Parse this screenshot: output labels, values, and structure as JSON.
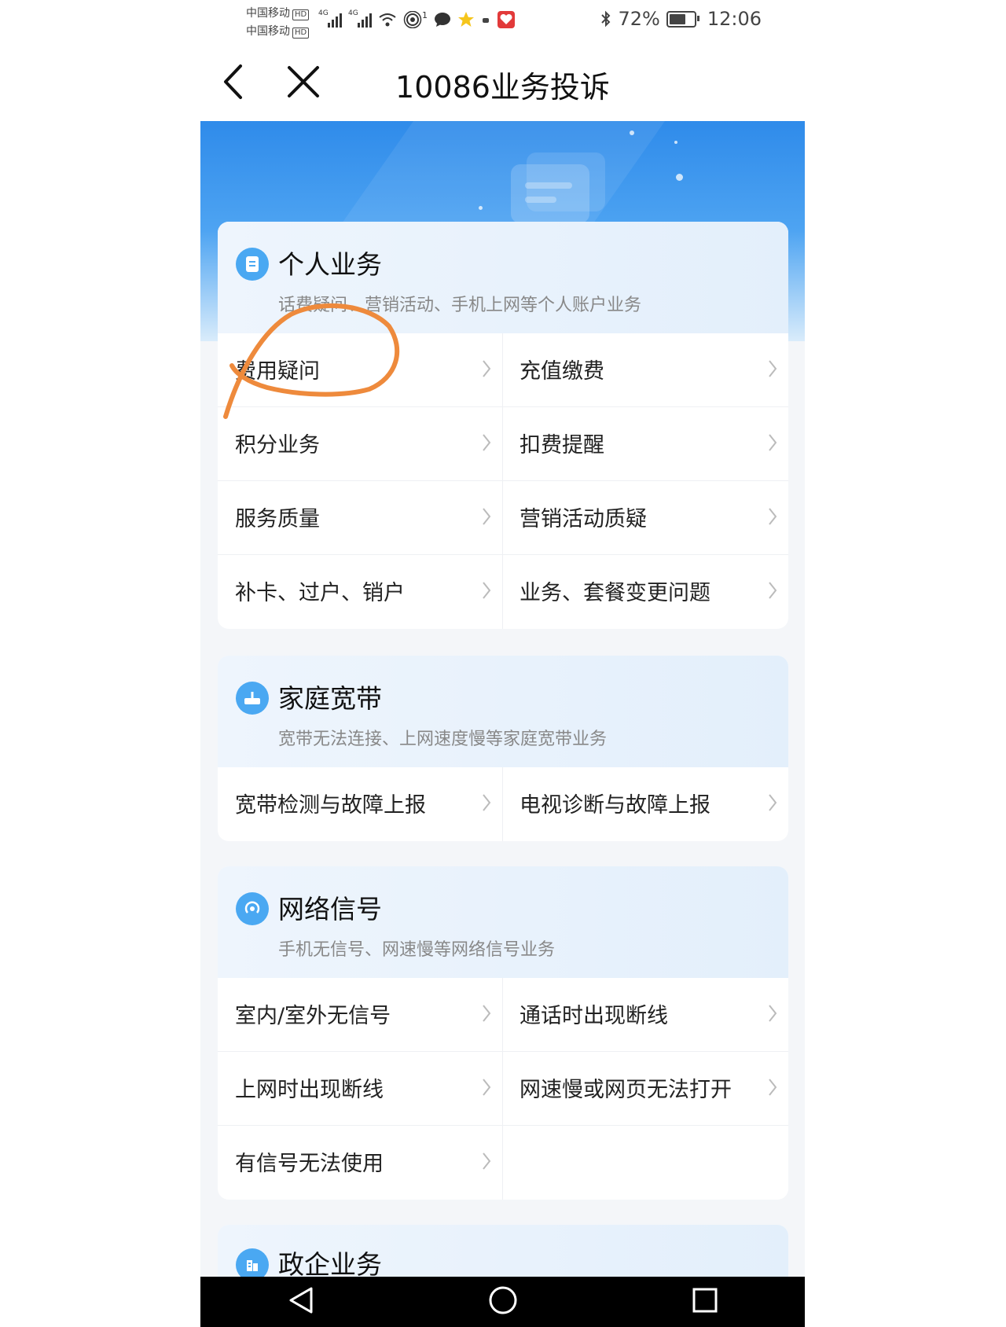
{
  "status_bar": {
    "carrier_1": "中国移动",
    "carrier_2": "中国移动",
    "hd_label": "HD",
    "network_1": "4G",
    "network_2": "4G",
    "hotspot_count": "1",
    "battery_percent": "72%",
    "battery_level": 0.72,
    "time": "12:06"
  },
  "header": {
    "title": "10086业务投诉"
  },
  "sections": [
    {
      "title": "个人业务",
      "subtitle": "话费疑问、营销活动、手机上网等个人账户业务",
      "items": [
        "费用疑问",
        "充值缴费",
        "积分业务",
        "扣费提醒",
        "服务质量",
        "营销活动质疑",
        "补卡、过户、销户",
        "业务、套餐变更问题"
      ]
    },
    {
      "title": "家庭宽带",
      "subtitle": "宽带无法连接、上网速度慢等家庭宽带业务",
      "items": [
        "宽带检测与故障上报",
        "电视诊断与故障上报"
      ]
    },
    {
      "title": "网络信号",
      "subtitle": "手机无信号、网速慢等网络信号业务",
      "items": [
        "室内/室外无信号",
        "通话时出现断线",
        "上网时出现断线",
        "网速慢或网页无法打开",
        "有信号无法使用"
      ]
    },
    {
      "title": "政企业务"
    }
  ],
  "colors": {
    "accent": "#4aa8f2",
    "banner_top": "#2f8bea",
    "annotation": "#ee8a3c"
  },
  "icons": {
    "back": "chevron-left-icon",
    "close": "close-icon",
    "personal": "document-icon",
    "broadband": "router-icon",
    "signal": "signal-icon",
    "enterprise": "building-icon"
  }
}
